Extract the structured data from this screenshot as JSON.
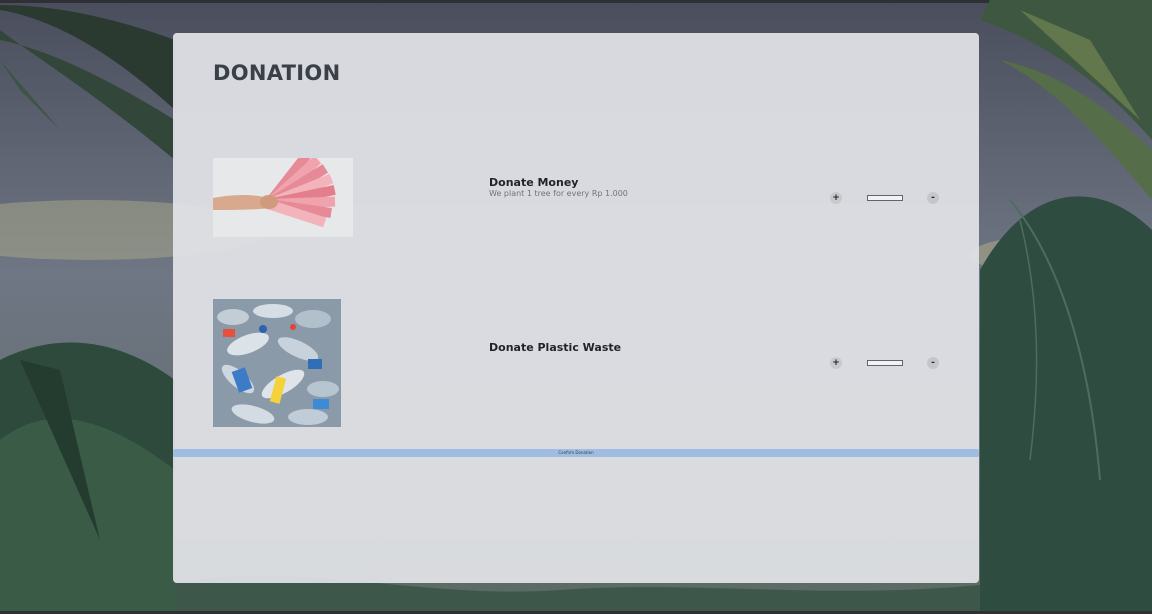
{
  "page": {
    "title": "DONATION"
  },
  "items": [
    {
      "title": "Donate Money",
      "subtitle": "We plant 1 tree for every Rp 1.000",
      "image_alt": "hand holding rupiah banknotes",
      "plus_label": "+",
      "minus_label": "-",
      "quantity": ""
    },
    {
      "title": "Donate Plastic Waste",
      "subtitle": "",
      "image_alt": "pile of plastic bottles",
      "plus_label": "+",
      "minus_label": "-",
      "quantity": ""
    }
  ],
  "confirm": {
    "label": "Confirm Donation"
  },
  "colors": {
    "card_bg": "#e2e3e7",
    "confirm_bar": "#9fbde3",
    "title_text": "#3a4048",
    "background_foliage": "#2f4a3c"
  }
}
